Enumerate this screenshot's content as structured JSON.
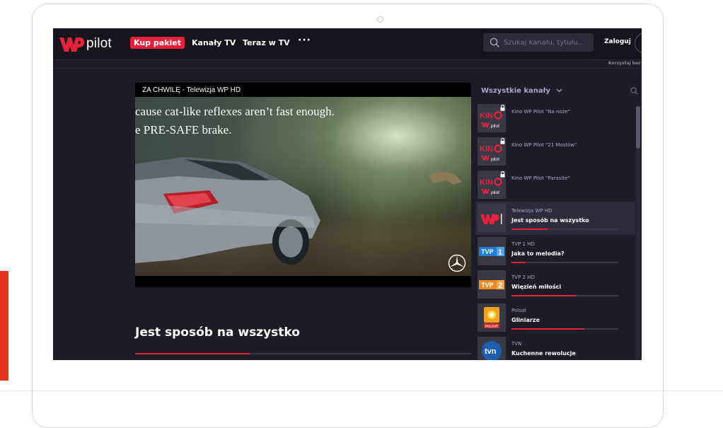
{
  "header": {
    "logo_text": "pilot",
    "buy_label": "Kup pakiet",
    "nav": [
      "Kanały TV",
      "Teraz w TV"
    ],
    "more_label": "···",
    "search_placeholder": "Szukaj kanału, tytułu...",
    "login_label": "Zaloguj",
    "sub_note": "Korzystaj bez"
  },
  "player": {
    "title": "ZA CHWILĘ - Telewizja WP HD",
    "subtitle_lines": [
      "cause cat-like reflexes aren’t fast enough.",
      "e PRE-SAFE brake."
    ]
  },
  "program": {
    "title": "Jest sposób na wszystko",
    "progress": 0.34
  },
  "channel_list": {
    "header": "Wszystkie kanały",
    "channels": [
      {
        "name": "Kino WP Pilot \"Na noże\"",
        "show": "",
        "logo": "kino-pilot",
        "locked": true,
        "progress": null
      },
      {
        "name": "Kino WP Pilot \"21 Mostów\"",
        "show": "",
        "logo": "kino-pilot",
        "locked": true,
        "progress": null
      },
      {
        "name": "Kino WP Pilot \"Parasite\"",
        "show": "",
        "logo": "kino-pilot",
        "locked": true,
        "progress": null
      },
      {
        "name": "Telewizja WP HD",
        "show": "Jest sposób na wszystko",
        "logo": "wp",
        "locked": false,
        "progress": 0.34,
        "active": true
      },
      {
        "name": "TVP 1 HD",
        "show": "Jaka to melodia?",
        "logo": "tvp1",
        "locked": false,
        "progress": 0.13
      },
      {
        "name": "TVP 2 HD",
        "show": "Więzień miłości",
        "logo": "tvp2",
        "locked": false,
        "progress": 0.6
      },
      {
        "name": "Polsat",
        "show": "Gliniarze",
        "logo": "polsat",
        "locked": false,
        "progress": 0.68
      },
      {
        "name": "TVN",
        "show": "Kuchenne rewolucje",
        "logo": "tvn",
        "locked": false,
        "progress": null
      }
    ]
  },
  "logo_texts": {
    "kino": "KIN",
    "pilot": "pilot",
    "tvp": "TVP",
    "tvp1_num": "1",
    "tvp2_num": "2",
    "polsat": "POLSAT",
    "tvn": "tvn"
  },
  "colors": {
    "accent": "#e8213d",
    "background": "#1e1d27",
    "topbar": "#16151d",
    "muted_text": "#a9a8cc"
  }
}
